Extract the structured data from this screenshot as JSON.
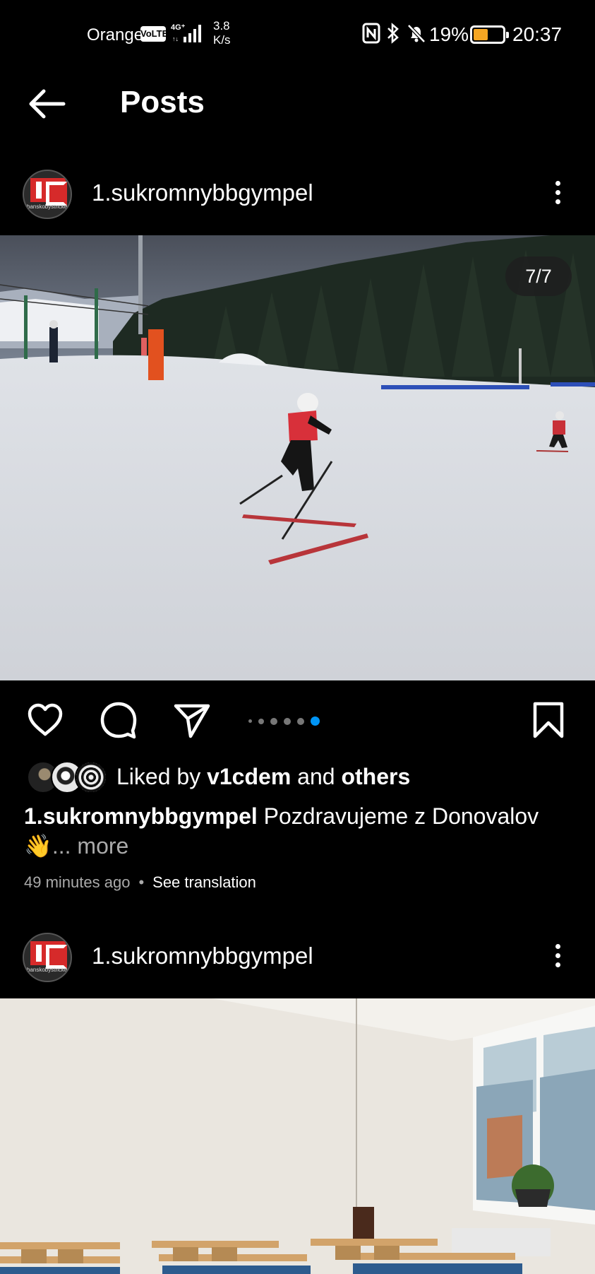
{
  "status_bar": {
    "carrier": "Orange",
    "volte": "VoLTE",
    "network": "4G⁺",
    "speed_value": "3.8",
    "speed_unit": "K/s",
    "battery_percent": "19%",
    "battery_level": 0.19,
    "time": "20:37",
    "icons": [
      "nfc-icon",
      "bluetooth-icon",
      "bell-muted-icon",
      "battery-icon"
    ]
  },
  "header": {
    "title": "Posts"
  },
  "post1": {
    "username": "1.sukromnybbgympel",
    "avatar_text": "banskobystrické",
    "counter": "7/7",
    "carousel": {
      "total": 6,
      "active": 5
    },
    "liked_by_prefix": "Liked by ",
    "liked_by_user": "v1cdem",
    "liked_by_and": " and ",
    "liked_by_others": "others",
    "caption_user": "1.sukromnybbgympel",
    "caption_text": " Pozdravujeme z Donovalov",
    "caption_emoji": "👋",
    "caption_more": "... more",
    "time_ago": "49 minutes ago",
    "meta_sep": "•",
    "see_translation": "See translation"
  },
  "post2": {
    "username": "1.sukromnybbgympel",
    "avatar_text": "banskobystrické"
  },
  "colors": {
    "background": "#000000",
    "active_dot": "#0095f6",
    "battery_fill": "#f5a623"
  }
}
